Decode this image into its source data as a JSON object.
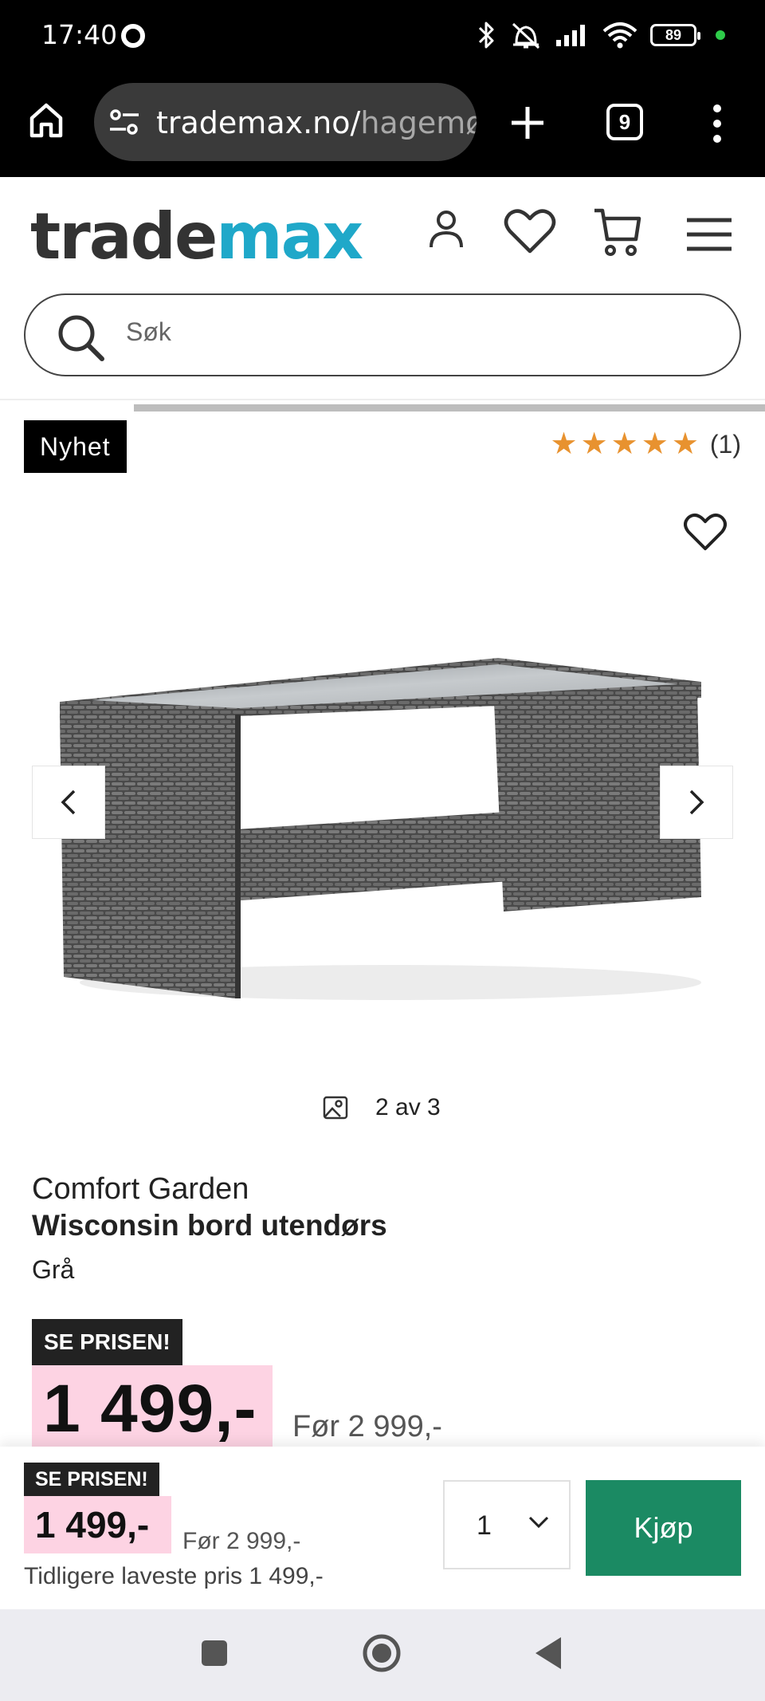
{
  "status_bar": {
    "time": "17:40",
    "battery": "89",
    "icons": [
      "bluetooth-icon",
      "vibrate-off-icon",
      "signal-icon",
      "wifi-icon",
      "battery-icon"
    ]
  },
  "browser": {
    "url_main": "trademax.no/",
    "url_rest": "hagemøl",
    "tab_count": "9"
  },
  "header": {
    "logo_part1": "trade",
    "logo_part2": "max",
    "search_placeholder": "Søk"
  },
  "gallery": {
    "badge": "Nyhet",
    "stars": 5,
    "rating_count": "(1)",
    "counter": "2 av 3"
  },
  "product": {
    "brand": "Comfort Garden",
    "name": "Wisconsin bord utendørs",
    "color": "Grå",
    "deal_badge": "SE PRISEN!",
    "price": "1 499,-",
    "before_price": "Før 2 999,-"
  },
  "buy_bar": {
    "deal_badge": "SE PRISEN!",
    "price": "1 499,-",
    "before_price": "Før 2 999,-",
    "lowest_price": "Tidligere laveste pris 1 499,-",
    "quantity": "1",
    "buy_label": "Kjøp"
  },
  "colors": {
    "accent": "#1fa8c9",
    "buy_button": "#1b8a63",
    "price_highlight": "#fdd3e3",
    "star": "#e8922f"
  }
}
